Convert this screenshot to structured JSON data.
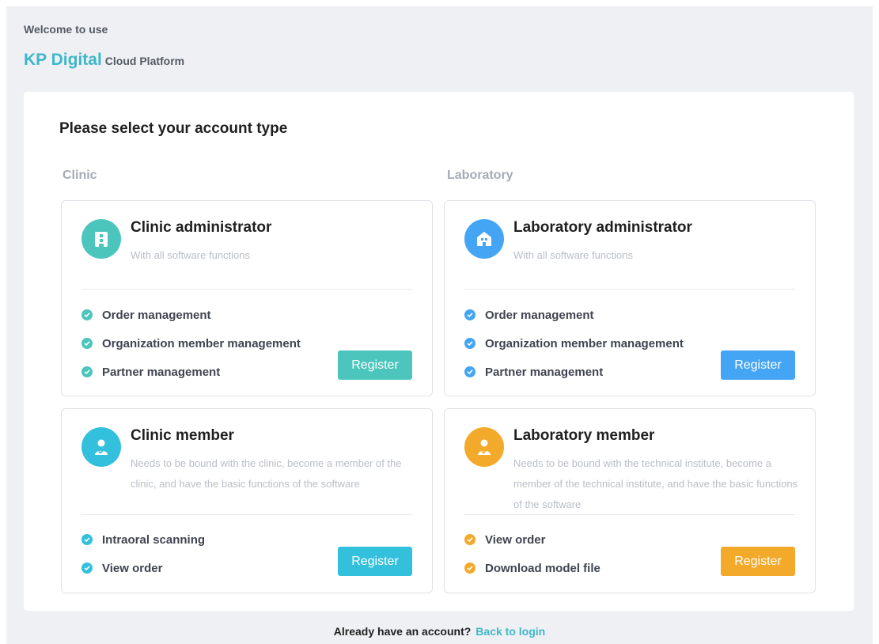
{
  "header": {
    "welcome": "Welcome to use",
    "brand_name": "KP Digital",
    "brand_sub": "Cloud Platform"
  },
  "panel": {
    "heading": "Please select your account type",
    "columns": {
      "clinic": "Clinic",
      "laboratory": "Laboratory"
    }
  },
  "cards": [
    {
      "title": "Clinic administrator",
      "description": "With all software functions",
      "features": [
        "Order management",
        "Organization member management",
        "Partner management"
      ],
      "button": "Register",
      "color": "#4cc5bd",
      "icon": "building-icon"
    },
    {
      "title": "Laboratory administrator",
      "description": "With all software functions",
      "features": [
        "Order management",
        "Organization member management",
        "Partner management"
      ],
      "button": "Register",
      "color": "#45a5f5",
      "icon": "house-icon"
    },
    {
      "title": "Clinic member",
      "description": "Needs to be bound with the clinic, become a member of the clinic, and have the basic functions of the software",
      "features": [
        "Intraoral scanning",
        "View order"
      ],
      "button": "Register",
      "color": "#33c0dc",
      "icon": "user-check-icon"
    },
    {
      "title": "Laboratory member",
      "description": "Needs to be bound with the technical institute, become a member of the technical institute, and have the basic functions of the software",
      "features": [
        "View order",
        "Download model file"
      ],
      "button": "Register",
      "color": "#f3a92a",
      "icon": "user-check-icon"
    }
  ],
  "footer": {
    "prompt": "Already have an account?",
    "link": "Back to login"
  }
}
